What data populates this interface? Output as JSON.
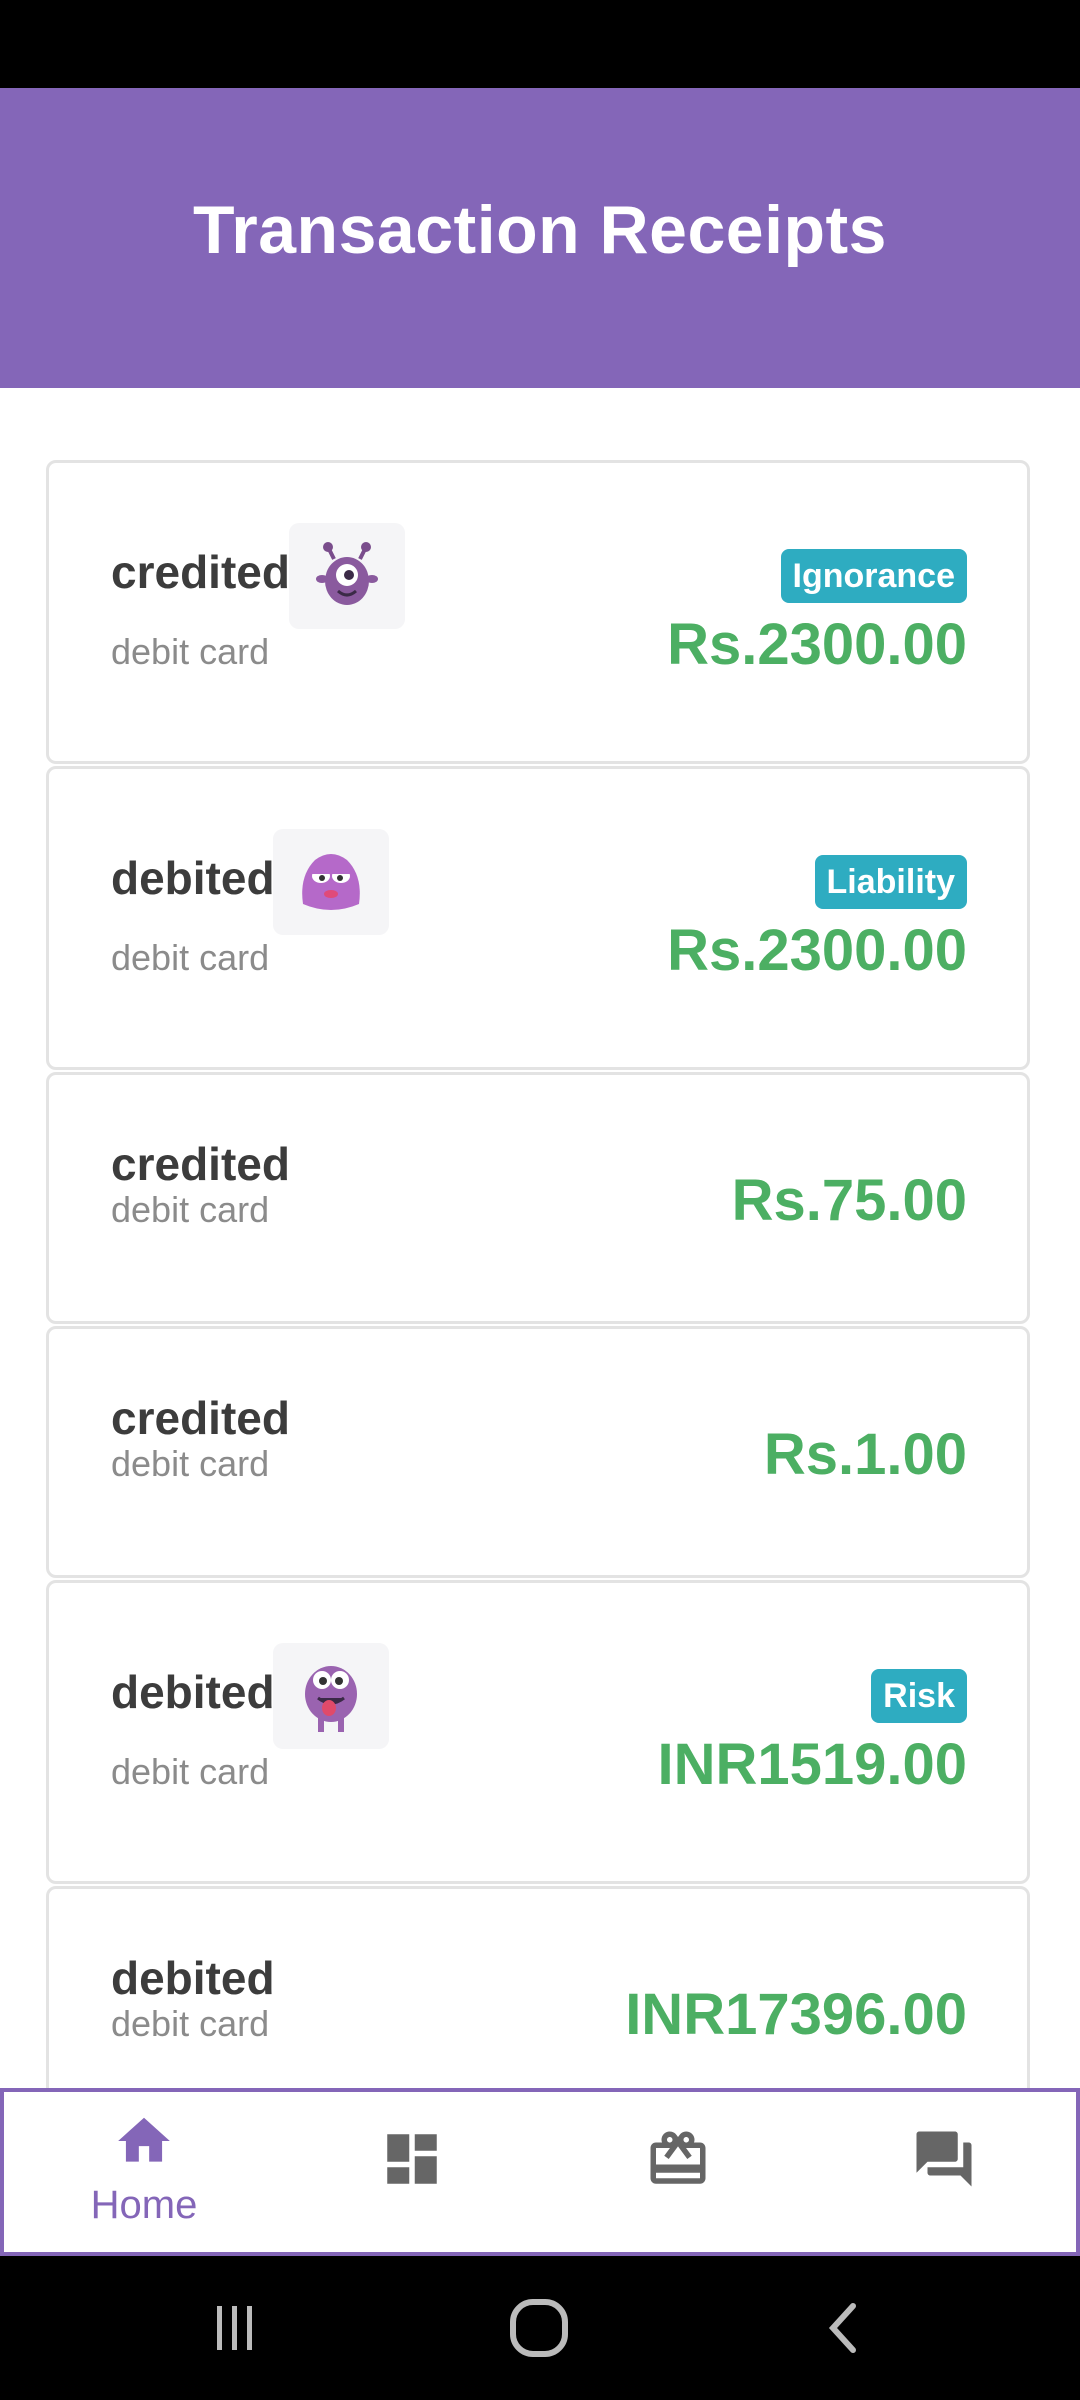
{
  "header": {
    "title": "Transaction Receipts"
  },
  "transactions": [
    {
      "type": "credited",
      "method": "debit card",
      "tag": "Ignorance",
      "amount": "Rs.2300.00",
      "avatar": "one-eyed-monster-icon"
    },
    {
      "type": "debited",
      "method": "debit card",
      "tag": "Liability",
      "amount": "Rs.2300.00",
      "avatar": "angry-blob-monster-icon"
    },
    {
      "type": "credited",
      "method": "debit card",
      "amount": "Rs.75.00"
    },
    {
      "type": "credited",
      "method": "debit card",
      "amount": "Rs.1.00"
    },
    {
      "type": "debited",
      "method": "debit card",
      "tag": "Risk",
      "amount": "INR1519.00",
      "avatar": "tongue-out-monster-icon"
    },
    {
      "type": "debited",
      "method": "debit card",
      "amount": "INR17396.00"
    }
  ],
  "bottom_nav": {
    "items": [
      {
        "label": "Home",
        "icon": "home-icon",
        "active": true
      },
      {
        "icon": "dashboard-icon"
      },
      {
        "icon": "gift-card-icon"
      },
      {
        "icon": "chat-icon"
      }
    ]
  },
  "colors": {
    "accent": "#8466b8",
    "amount": "#4caf63",
    "tag": "#2eacc1"
  },
  "system_nav": [
    "recent-apps-icon",
    "home-circle-icon",
    "back-icon"
  ]
}
